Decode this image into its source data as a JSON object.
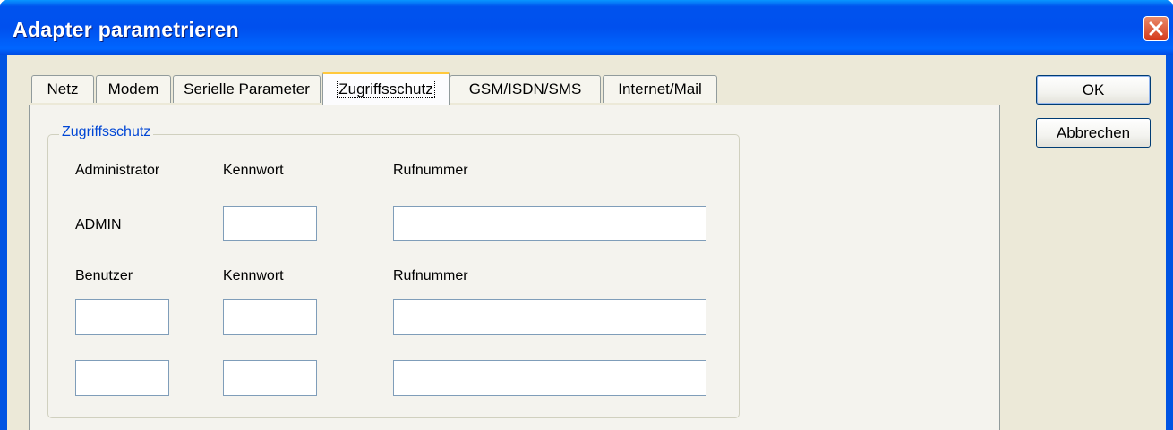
{
  "window": {
    "title": "Adapter parametrieren"
  },
  "tabs": [
    {
      "label": "Netz"
    },
    {
      "label": "Modem"
    },
    {
      "label": "Serielle Parameter"
    },
    {
      "label": "Zugriffsschutz"
    },
    {
      "label": "GSM/ISDN/SMS"
    },
    {
      "label": "Internet/Mail"
    }
  ],
  "active_tab": "Zugriffsschutz",
  "group": {
    "title": "Zugriffsschutz",
    "admin_header": "Administrator",
    "kennwort_header_1": "Kennwort",
    "rufnummer_header_1": "Rufnummer",
    "admin_name": "ADMIN",
    "benutzer_header": "Benutzer",
    "kennwort_header_2": "Kennwort",
    "rufnummer_header_2": "Rufnummer"
  },
  "fields": {
    "admin_kennwort": "",
    "admin_rufnummer": "",
    "user1_name": "",
    "user1_kennwort": "",
    "user1_rufnummer": "",
    "user2_name": "",
    "user2_kennwort": "",
    "user2_rufnummer": ""
  },
  "buttons": {
    "ok": "OK",
    "cancel": "Abbrechen"
  },
  "colors": {
    "titlebar": "#0054e3",
    "accent_tab": "#ffc83c",
    "group_title": "#0046d5"
  }
}
